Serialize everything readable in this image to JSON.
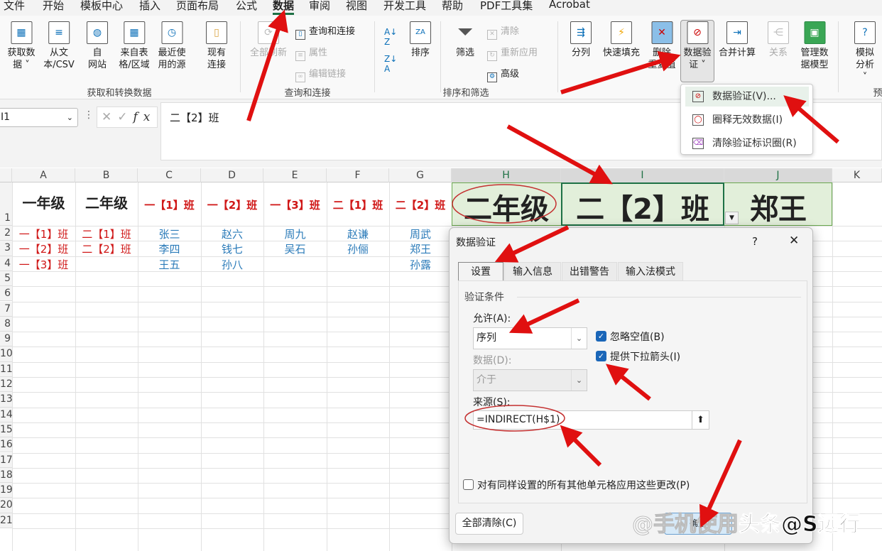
{
  "menu_tabs": [
    "文件",
    "开始",
    "模板中心",
    "插入",
    "页面布局",
    "公式",
    "数据",
    "审阅",
    "视图",
    "开发工具",
    "帮助",
    "PDF工具集",
    "Acrobat"
  ],
  "active_tab": "数据",
  "ribbon": {
    "get_data": "获取数\n据 ˅",
    "from_text": "从文\n本/CSV",
    "from_web": "自\n网站",
    "from_table": "来自表\n格/区域",
    "recent_sources": "最近使\n用的源",
    "existing_conn": "现有\n连接",
    "refresh_all": "全部刷新\n˅",
    "queries_conn": "查询和连接",
    "properties": "属性",
    "edit_links": "编辑链接",
    "sort": "排序",
    "filter": "筛选",
    "clear": "清除",
    "reapply": "重新应用",
    "advanced": "高级",
    "text_to_columns": "分列",
    "flash_fill": "快速填充",
    "remove_dup": "删除\n重复值",
    "data_validation": "数据验\n证 ˅",
    "consolidate": "合并计算",
    "relationships": "关系",
    "manage_model": "管理数\n据模型",
    "what_if": "模拟分析\n˅",
    "groups": {
      "get_transform": "获取和转换数据",
      "queries": "查询和连接",
      "sort_filter": "排序和筛选",
      "forecast": "预"
    }
  },
  "dv_menu": {
    "items": [
      "数据验证(V)...",
      "圈释无效数据(I)",
      "清除验证标识圈(R)"
    ]
  },
  "formula_bar": {
    "name_box": "I1",
    "formula": "二【2】班"
  },
  "columns": [
    "A",
    "B",
    "C",
    "D",
    "E",
    "F",
    "G",
    "H",
    "I",
    "J",
    "K"
  ],
  "rows": [
    "1",
    "2",
    "3",
    "4",
    "5",
    "6",
    "7",
    "8",
    "9",
    "10",
    "11",
    "12",
    "13",
    "14",
    "15",
    "16",
    "17",
    "18",
    "19",
    "20",
    "21"
  ],
  "sheet": {
    "A1": "一年级",
    "B1": "二年级",
    "C1": "一【1】班",
    "D1": "一【2】班",
    "E1": "一【3】班",
    "F1": "二【1】班",
    "G1": "二【2】班",
    "H1": "二年级",
    "I1": "二【2】班",
    "J1": "郑王",
    "A": [
      "一【1】班",
      "一【2】班",
      "一【3】班"
    ],
    "B": [
      "二【1】班",
      "二【2】班"
    ],
    "C": [
      "张三",
      "李四",
      "王五"
    ],
    "D": [
      "赵六",
      "钱七",
      "孙八"
    ],
    "E": [
      "周九",
      "吴石"
    ],
    "F": [
      "赵谦",
      "孙俪"
    ],
    "G": [
      "周武",
      "郑王",
      "孙露"
    ]
  },
  "dialog": {
    "title": "数据验证",
    "help": "?",
    "close": "✕",
    "tabs": [
      "设置",
      "输入信息",
      "出错警告",
      "输入法模式"
    ],
    "section": "验证条件",
    "allow_label": "允许(A):",
    "allow_value": "序列",
    "data_label": "数据(D):",
    "data_value": "介于",
    "ignore_blank": "忽略空值(B)",
    "ignore_blank_checked": true,
    "dropdown": "提供下拉箭头(I)",
    "dropdown_checked": true,
    "source_label": "来源(S):",
    "source_value": "=INDIRECT(H$1)",
    "apply_all": "对有同样设置的所有其他单元格应用这些更改(P)",
    "apply_all_checked": false,
    "clear_all": "全部清除(C)",
    "ok": "确定"
  },
  "watermark": {
    "part1": "@手机使用",
    "part2": "头条@S远行"
  },
  "colors": {
    "accent": "#1e7145",
    "annotation": "#e01010",
    "header_red": "#d01818",
    "name_blue": "#2b7bb9",
    "highlight_fill": "#e2efda"
  }
}
